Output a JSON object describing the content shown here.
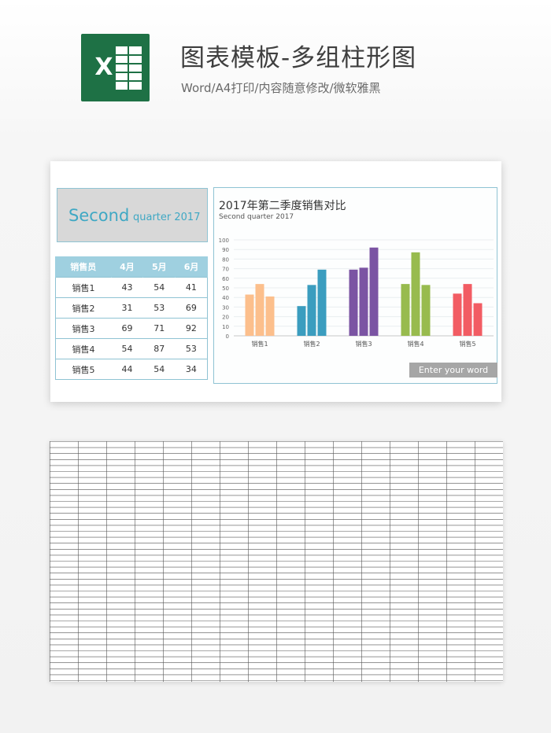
{
  "header": {
    "title": "图表模板-多组柱形图",
    "subtitle": "Word/A4打印/内容随意修改/微软雅黑",
    "logo_letter": "X"
  },
  "title_box": {
    "big": "Second",
    "small": "quarter  2017"
  },
  "table": {
    "headers": [
      "销售员",
      "4月",
      "5月",
      "6月"
    ],
    "rows": [
      [
        "销售1",
        "43",
        "54",
        "41"
      ],
      [
        "销售2",
        "31",
        "53",
        "69"
      ],
      [
        "销售3",
        "69",
        "71",
        "92"
      ],
      [
        "销售4",
        "54",
        "87",
        "53"
      ],
      [
        "销售5",
        "44",
        "54",
        "34"
      ]
    ]
  },
  "chart": {
    "button_label": "Enter your word"
  },
  "chart_data": {
    "type": "bar",
    "title": "2017年第二季度销售对比",
    "subtitle": "Second quarter 2017",
    "categories": [
      "销售1",
      "销售2",
      "销售3",
      "销售4",
      "销售5"
    ],
    "group_values": [
      [
        43,
        54,
        41
      ],
      [
        31,
        53,
        69
      ],
      [
        69,
        71,
        92
      ],
      [
        54,
        87,
        53
      ],
      [
        44,
        54,
        34
      ]
    ],
    "group_colors": [
      [
        "#fcbf8c",
        "#fcbf8c",
        "#fcbf8c"
      ],
      [
        "#3b9dbf",
        "#3b9dbf",
        "#3b9dbf"
      ],
      [
        "#7b54a3",
        "#7b54a3",
        "#7b54a3"
      ],
      [
        "#98bb4e",
        "#98bb4e",
        "#98bb4e"
      ],
      [
        "#f25c63",
        "#f25c63",
        "#f25c63"
      ]
    ],
    "yticks": [
      0,
      10,
      20,
      30,
      40,
      50,
      60,
      70,
      80,
      90,
      100
    ],
    "ylim": [
      0,
      100
    ],
    "grid": true,
    "xlabel": "",
    "ylabel": ""
  }
}
